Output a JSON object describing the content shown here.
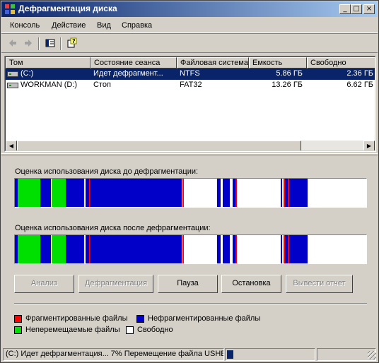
{
  "window": {
    "title": "Дефрагментация диска",
    "controls": {
      "minimize": "_",
      "maximize": "□",
      "close": "×"
    }
  },
  "menu": {
    "items": [
      "Консоль",
      "Действие",
      "Вид",
      "Справка"
    ]
  },
  "toolbar": {
    "icons": [
      "back-arrow-icon",
      "forward-arrow-icon",
      "show-hide-tree-icon",
      "help-icon"
    ]
  },
  "volumes": {
    "columns": [
      "Том",
      "Состояние сеанса",
      "Файловая система",
      "Емкость",
      "Свободно"
    ],
    "rows": [
      {
        "volume": "(C:)",
        "state": "Идет дефрагмент...",
        "fs": "NTFS",
        "capacity": "5.86 ГБ",
        "free": "2.36 ГБ",
        "selected": true
      },
      {
        "volume": "WORKMAN (D:)",
        "state": "Стоп",
        "fs": "FAT32",
        "capacity": "13.26 ГБ",
        "free": "6.62 ГБ",
        "selected": false
      }
    ]
  },
  "analysis": {
    "before_label": "Оценка использования диска до дефрагментации:",
    "after_label": "Оценка использования диска после дефрагментации:"
  },
  "colors": {
    "fragmented": "#ff0000",
    "contiguous": "#0000c8",
    "unmovable": "#00e000",
    "free": "#ffffff",
    "selection": "#0a246a"
  },
  "disk_map_segments": [
    {
      "type": "contiguous",
      "start": 0.0,
      "end": 0.008
    },
    {
      "type": "unmovable",
      "start": 0.008,
      "end": 0.073
    },
    {
      "type": "contiguous",
      "start": 0.073,
      "end": 0.104
    },
    {
      "type": "unmovable",
      "start": 0.104,
      "end": 0.144
    },
    {
      "type": "contiguous",
      "start": 0.144,
      "end": 0.198
    },
    {
      "type": "free",
      "start": 0.198,
      "end": 0.202
    },
    {
      "type": "contiguous",
      "start": 0.202,
      "end": 0.212
    },
    {
      "type": "fragmented",
      "start": 0.212,
      "end": 0.214
    },
    {
      "type": "contiguous",
      "start": 0.214,
      "end": 0.476
    },
    {
      "type": "fragmented",
      "start": 0.476,
      "end": 0.48
    },
    {
      "type": "free",
      "start": 0.48,
      "end": 0.575
    },
    {
      "type": "contiguous",
      "start": 0.575,
      "end": 0.585
    },
    {
      "type": "free",
      "start": 0.585,
      "end": 0.591
    },
    {
      "type": "contiguous",
      "start": 0.591,
      "end": 0.612
    },
    {
      "type": "free",
      "start": 0.612,
      "end": 0.619
    },
    {
      "type": "contiguous",
      "start": 0.619,
      "end": 0.627
    },
    {
      "type": "fragmented",
      "start": 0.627,
      "end": 0.631
    },
    {
      "type": "free",
      "start": 0.631,
      "end": 0.756
    },
    {
      "type": "contiguous",
      "start": 0.756,
      "end": 0.76
    },
    {
      "type": "free",
      "start": 0.76,
      "end": 0.764
    },
    {
      "type": "fragmented",
      "start": 0.764,
      "end": 0.768
    },
    {
      "type": "contiguous",
      "start": 0.768,
      "end": 0.776
    },
    {
      "type": "fragmented",
      "start": 0.776,
      "end": 0.78
    },
    {
      "type": "contiguous",
      "start": 0.78,
      "end": 0.832
    },
    {
      "type": "free",
      "start": 0.832,
      "end": 1.0
    }
  ],
  "buttons": [
    {
      "label": "Анализ",
      "enabled": false
    },
    {
      "label": "Дефрагментация",
      "enabled": false
    },
    {
      "label": "Пауза",
      "enabled": true
    },
    {
      "label": "Остановка",
      "enabled": true
    },
    {
      "label": "Вывести отчет",
      "enabled": false
    }
  ],
  "legend": [
    {
      "label": "Фрагментированные файлы",
      "color": "#ff0000"
    },
    {
      "label": "Нефрагментированные файлы",
      "color": "#0000c8"
    },
    {
      "label": "Неперемещаемые файлы",
      "color": "#00e000"
    },
    {
      "label": "Свободно",
      "color": "#ffffff"
    }
  ],
  "status": {
    "text": "(C:) Идет дефрагментация...  7%  Перемещение файла USHE",
    "progress_fraction": 0.07
  }
}
